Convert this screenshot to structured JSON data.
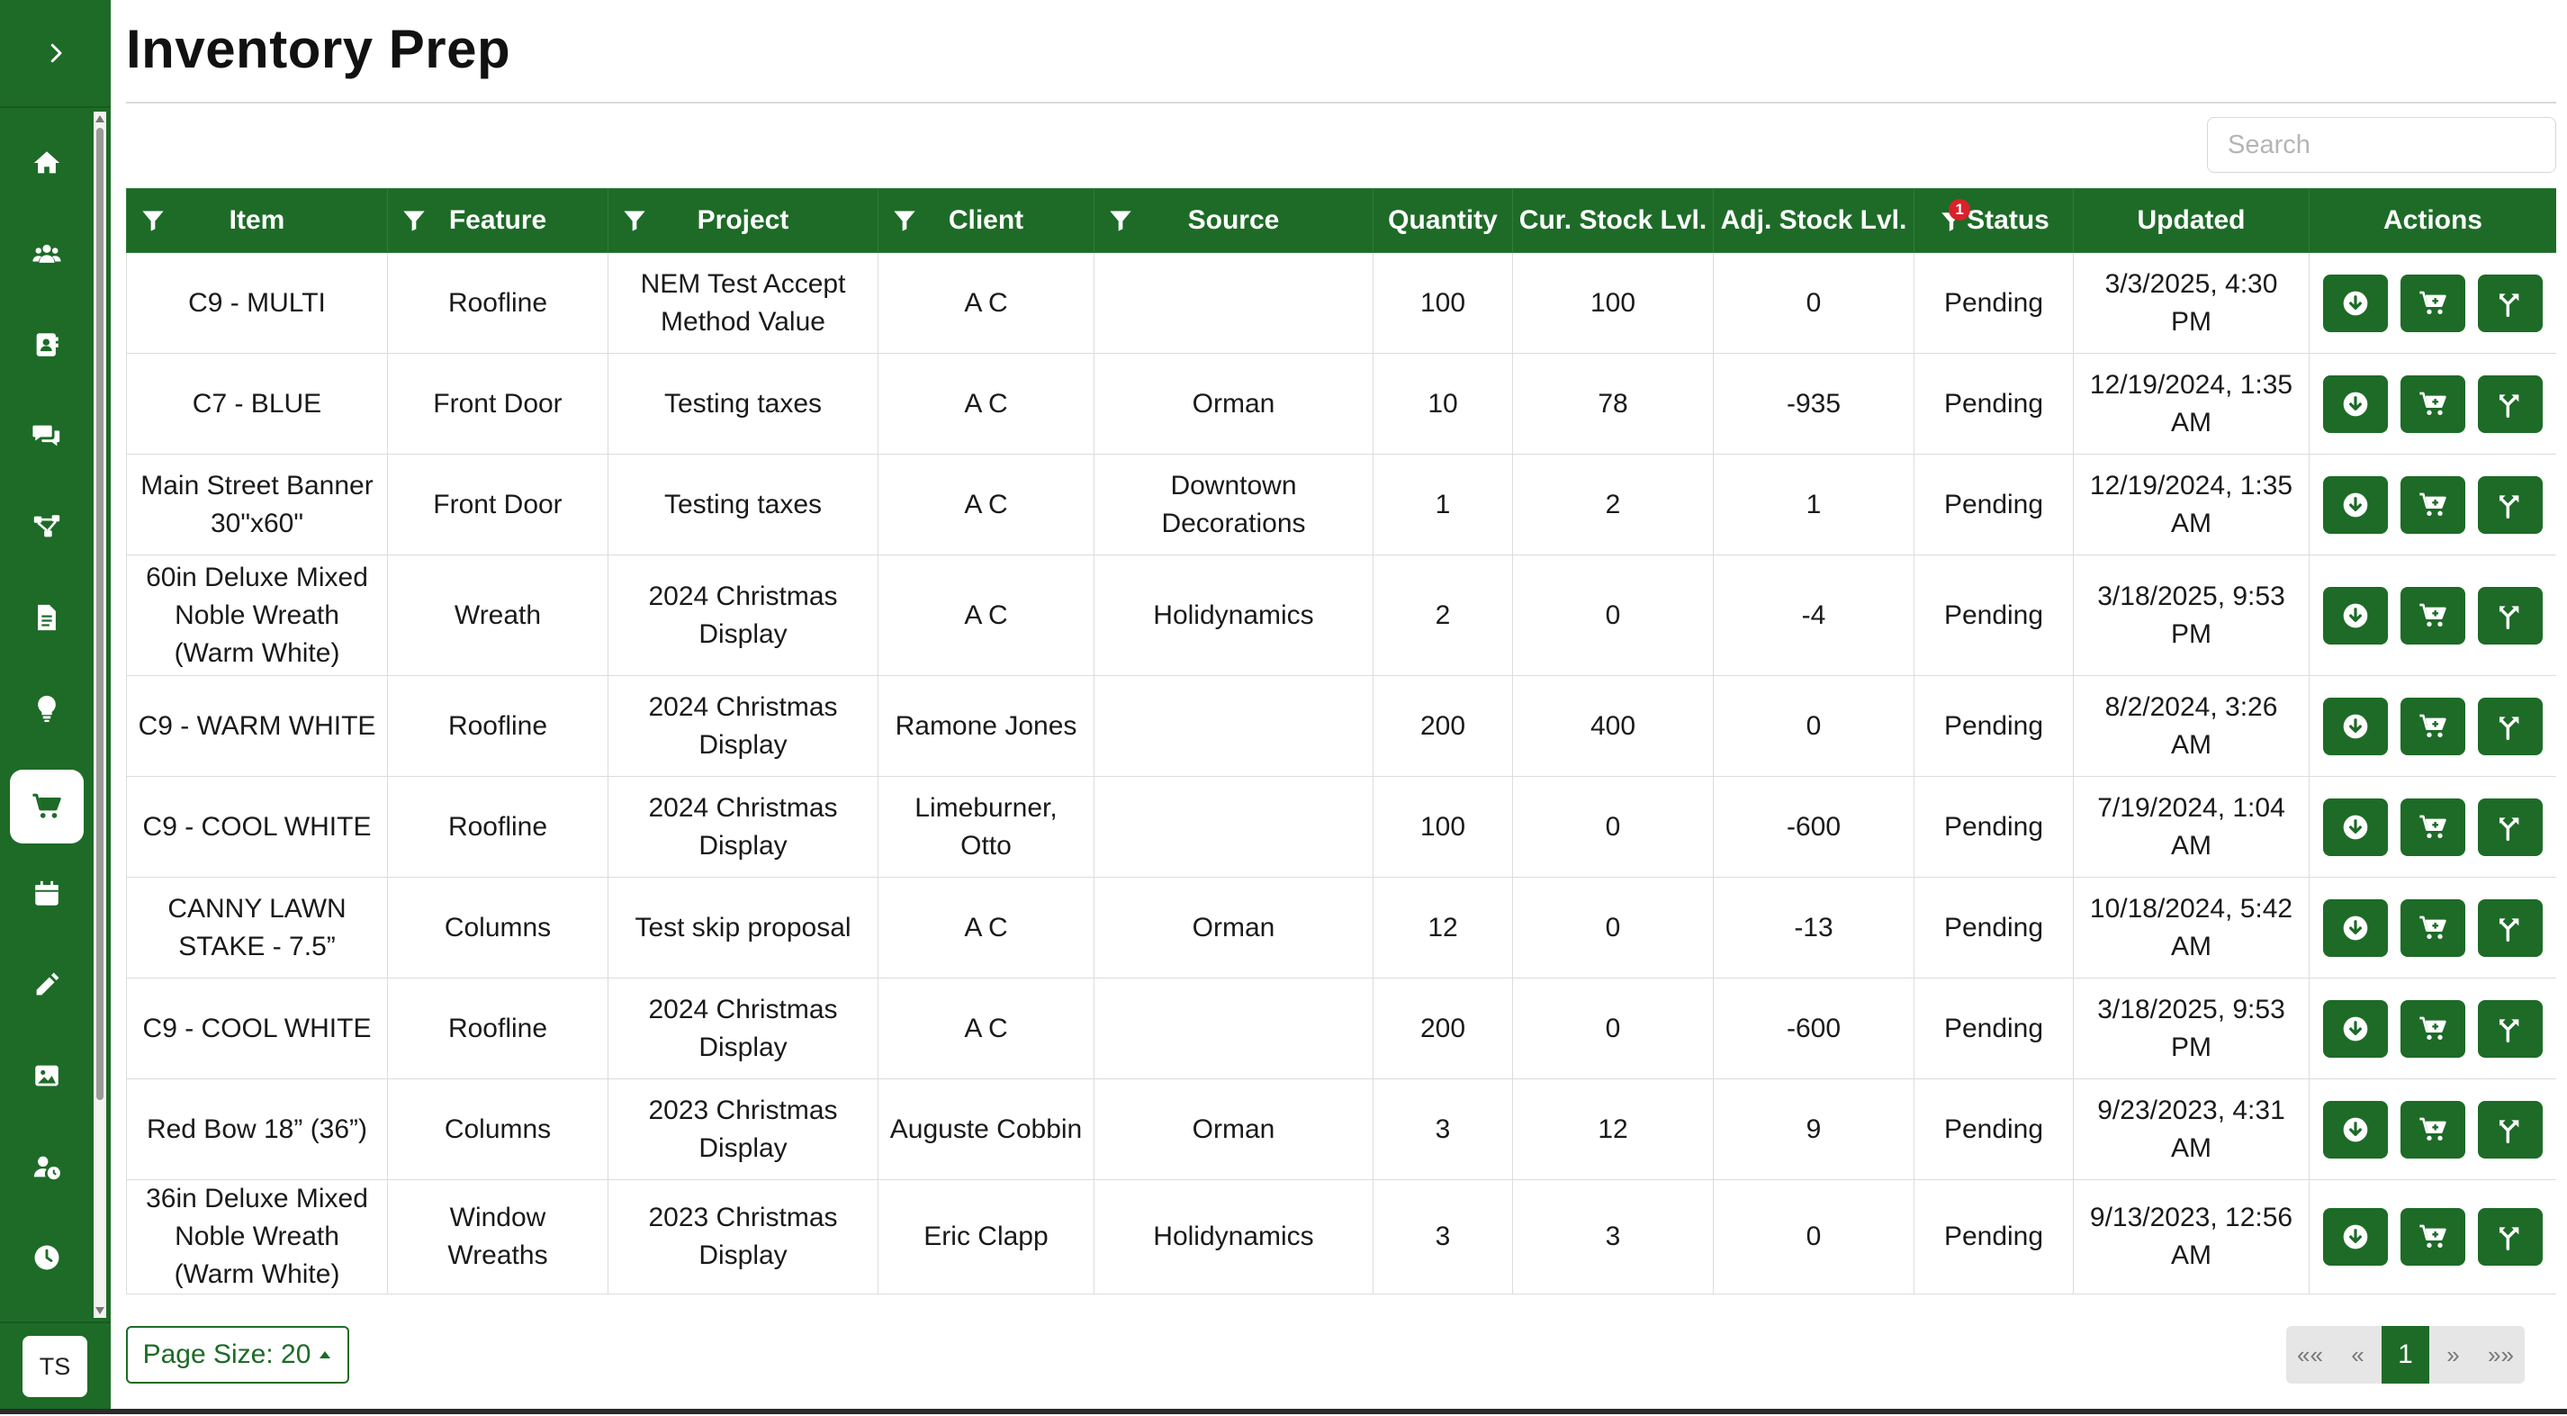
{
  "page": {
    "title": "Inventory Prep"
  },
  "search": {
    "placeholder": "Search",
    "value": ""
  },
  "sidebar": {
    "items": [
      {
        "name": "home-icon"
      },
      {
        "name": "users-icon"
      },
      {
        "name": "contacts-icon"
      },
      {
        "name": "chat-icon"
      },
      {
        "name": "workflow-icon"
      },
      {
        "name": "document-icon"
      },
      {
        "name": "lightbulb-icon"
      },
      {
        "name": "cart-icon",
        "active": true
      },
      {
        "name": "calendar-icon"
      },
      {
        "name": "pencil-icon"
      },
      {
        "name": "image-icon"
      },
      {
        "name": "user-clock-icon"
      },
      {
        "name": "clock-icon"
      }
    ],
    "user_initials": "TS"
  },
  "table": {
    "columns": [
      "Item",
      "Feature",
      "Project",
      "Client",
      "Source",
      "Quantity",
      "Cur. Stock Lvl.",
      "Adj. Stock Lvl.",
      "Status",
      "Updated",
      "Actions"
    ],
    "status_filter_count": "1",
    "rows": [
      [
        "C9 - MULTI",
        "Roofline",
        "NEM Test Accept Method Value",
        "A C",
        "",
        "100",
        "100",
        "0",
        "Pending",
        "3/3/2025, 4:30 PM"
      ],
      [
        "C7 - BLUE",
        "Front Door",
        "Testing taxes",
        "A C",
        "Orman",
        "10",
        "78",
        "-935",
        "Pending",
        "12/19/2024, 1:35 AM"
      ],
      [
        "Main Street Banner 30\"x60\"",
        "Front Door",
        "Testing taxes",
        "A C",
        "Downtown Decorations",
        "1",
        "2",
        "1",
        "Pending",
        "12/19/2024, 1:35 AM"
      ],
      [
        "60in Deluxe Mixed Noble Wreath (Warm White)",
        "Wreath",
        "2024 Christmas Display",
        "A C",
        "Holidynamics",
        "2",
        "0",
        "-4",
        "Pending",
        "3/18/2025, 9:53 PM"
      ],
      [
        "C9 - WARM WHITE",
        "Roofline",
        "2024 Christmas Display",
        "Ramone Jones",
        "",
        "200",
        "400",
        "0",
        "Pending",
        "8/2/2024, 3:26 AM"
      ],
      [
        "C9 - COOL WHITE",
        "Roofline",
        "2024 Christmas Display",
        "Limeburner, Otto",
        "",
        "100",
        "0",
        "-600",
        "Pending",
        "7/19/2024, 1:04 AM"
      ],
      [
        "CANNY LAWN STAKE - 7.5”",
        "Columns",
        "Test skip proposal",
        "A C",
        "Orman",
        "12",
        "0",
        "-13",
        "Pending",
        "10/18/2024, 5:42 AM"
      ],
      [
        "C9 - COOL WHITE",
        "Roofline",
        "2024 Christmas Display",
        "A C",
        "",
        "200",
        "0",
        "-600",
        "Pending",
        "3/18/2025, 9:53 PM"
      ],
      [
        "Red Bow 18” (36”)",
        "Columns",
        "2023 Christmas Display",
        "Auguste Cobbin",
        "Orman",
        "3",
        "12",
        "9",
        "Pending",
        "9/23/2023, 4:31 AM"
      ],
      [
        "36in Deluxe Mixed Noble Wreath (Warm White)",
        "Window Wreaths",
        "2023 Christmas Display",
        "Eric Clapp",
        "Holidynamics",
        "3",
        "3",
        "0",
        "Pending",
        "9/13/2023, 12:56 AM"
      ]
    ],
    "row_actions": [
      "download-icon",
      "cart-plus-icon",
      "fork-icon"
    ]
  },
  "footer": {
    "page_size_label": "Page Size: 20",
    "pager": {
      "first": "««",
      "prev": "«",
      "current": "1",
      "next": "»",
      "last": "»»"
    }
  },
  "colors": {
    "primary": "#1d6b27",
    "badge": "#d9222a"
  }
}
